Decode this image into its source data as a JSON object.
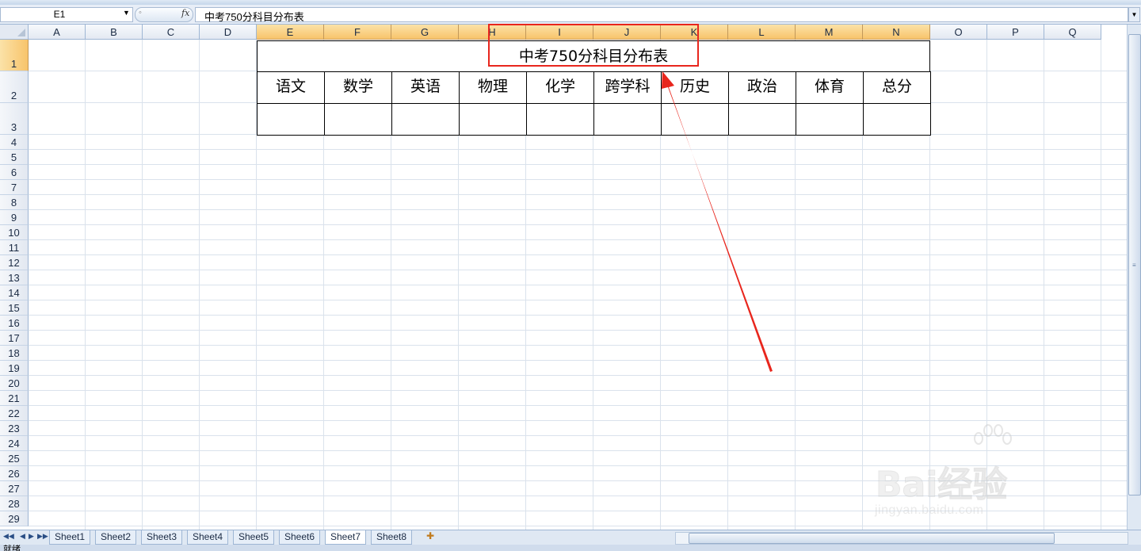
{
  "name_box": {
    "value": "E1"
  },
  "formula_bar": {
    "fx_label": "fx",
    "content": "中考750分科目分布表"
  },
  "columns": [
    {
      "label": "A"
    },
    {
      "label": "B"
    },
    {
      "label": "C"
    },
    {
      "label": "D"
    },
    {
      "label": "E"
    },
    {
      "label": "F"
    },
    {
      "label": "G"
    },
    {
      "label": "H"
    },
    {
      "label": "I"
    },
    {
      "label": "J"
    },
    {
      "label": "K"
    },
    {
      "label": "L"
    },
    {
      "label": "M"
    },
    {
      "label": "N"
    },
    {
      "label": "O"
    },
    {
      "label": "P"
    },
    {
      "label": "Q"
    }
  ],
  "selected_columns": [
    "E",
    "F",
    "G",
    "H",
    "I",
    "J",
    "K",
    "L",
    "M",
    "N"
  ],
  "rows": [
    "1",
    "2",
    "3",
    "4",
    "5",
    "6",
    "7",
    "8",
    "9",
    "10",
    "11",
    "12",
    "13",
    "14",
    "15",
    "16",
    "17",
    "18",
    "19",
    "20",
    "21",
    "22",
    "23",
    "24",
    "25",
    "26",
    "27",
    "28",
    "29"
  ],
  "selected_row": "1",
  "table": {
    "title": "中考750分科目分布表",
    "headers": [
      "语文",
      "数学",
      "英语",
      "物理",
      "化学",
      "跨学科",
      "历史",
      "政治",
      "体育",
      "总分"
    ],
    "values": [
      "",
      "",
      "",
      "",
      "",
      "",
      "",
      "",
      "",
      ""
    ]
  },
  "sheets": [
    "Sheet1",
    "Sheet2",
    "Sheet3",
    "Sheet4",
    "Sheet5",
    "Sheet6",
    "Sheet7",
    "Sheet8"
  ],
  "active_sheet": "Sheet7",
  "status": {
    "text": "就绪"
  },
  "watermark": {
    "brand": "Bai经验",
    "url": "jingyan.baidu.com"
  },
  "annotation": {
    "color": "#e8261d"
  }
}
